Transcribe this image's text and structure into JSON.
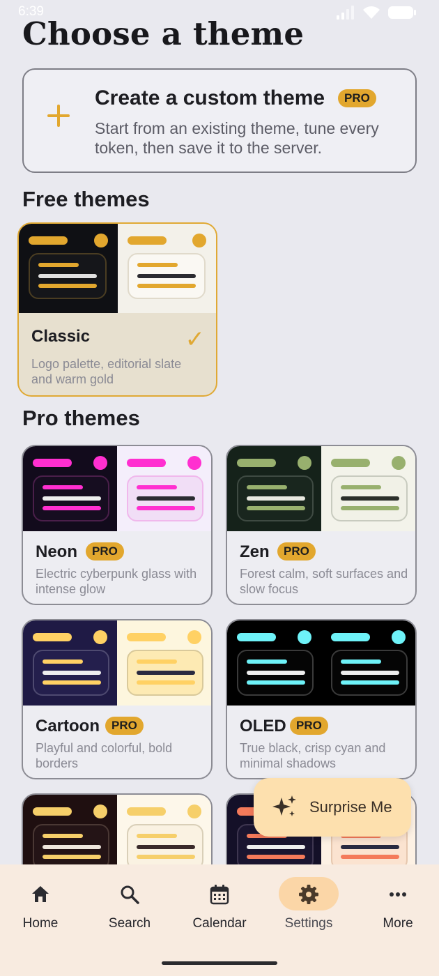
{
  "status": {
    "time": "6:39"
  },
  "page": {
    "title": "Choose a theme"
  },
  "custom_theme": {
    "title": "Create a custom theme",
    "badge": "PRO",
    "description": "Start from an existing theme, tune every token, then save it to the server."
  },
  "sections": {
    "free": "Free themes",
    "pro": "Pro themes"
  },
  "free_themes": [
    {
      "name": "Classic",
      "description": "Logo palette, editorial slate and warm gold",
      "selected": true
    }
  ],
  "pro_themes": [
    {
      "name": "Neon",
      "badge": "PRO",
      "description": "Electric cyberpunk glass with intense glow"
    },
    {
      "name": "Zen",
      "badge": "PRO",
      "description": "Forest calm, soft surfaces and slow focus"
    },
    {
      "name": "Cartoon",
      "badge": "PRO",
      "description": "Playful and colorful, bold borders"
    },
    {
      "name": "OLED",
      "badge": "PRO",
      "description": "True black, crisp cyan and minimal shadows"
    }
  ],
  "fab": {
    "label": "Surprise Me",
    "icon": "sparkles-icon"
  },
  "nav": {
    "items": [
      {
        "label": "Home",
        "icon": "home-icon"
      },
      {
        "label": "Search",
        "icon": "search-icon"
      },
      {
        "label": "Calendar",
        "icon": "calendar-icon"
      },
      {
        "label": "Settings",
        "icon": "gear-icon",
        "active": true
      },
      {
        "label": "More",
        "icon": "more-icon"
      }
    ]
  },
  "colors": {
    "accent": "#e2a72e",
    "selected_card": "#e7e0cf",
    "nav_bg": "#f8ebe0",
    "fab_bg": "#fde0ae"
  }
}
